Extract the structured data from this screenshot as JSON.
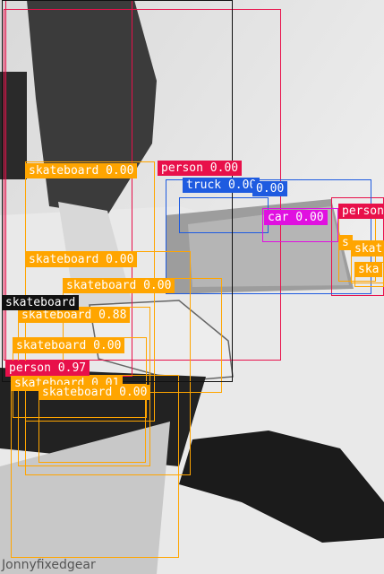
{
  "image": {
    "watermark": "Jonnyfixedgear"
  },
  "colors": {
    "skateboard": "#ffa500",
    "person": "#e8104a",
    "truck": "#1e5be0",
    "car": "#e010e0",
    "black": "#111111"
  },
  "detections": [
    {
      "id": "person-top",
      "class": "person",
      "text": "person 0.00",
      "tagpos": "inside-top"
    },
    {
      "id": "person-right",
      "class": "person",
      "text": "person",
      "tagpos": "inside-top"
    },
    {
      "id": "person-mid",
      "class": "person",
      "text": "person 0.97",
      "tagpos": "inside-top"
    },
    {
      "id": "truck-1",
      "class": "truck",
      "text": "truck 0.00",
      "tagpos": "inside-top"
    },
    {
      "id": "truck-2",
      "class": "truck",
      "text": "0.00",
      "tagpos": "inside-top"
    },
    {
      "id": "car-1",
      "class": "car",
      "text": "car 0.00",
      "tagpos": "inside-top"
    },
    {
      "id": "sk-a",
      "class": "skateboard",
      "text": "skateboard 0.00",
      "tagpos": "inside-top"
    },
    {
      "id": "sk-b",
      "class": "skateboard",
      "text": "skateboard 0.00",
      "tagpos": "inside-top"
    },
    {
      "id": "sk-c",
      "class": "skateboard",
      "text": "skateboard 0.00",
      "tagpos": "inside-top"
    },
    {
      "id": "sk-d",
      "class": "skateboard",
      "text": "skateboard 0.88",
      "tagpos": "inside-top"
    },
    {
      "id": "sk-e",
      "class": "skateboard",
      "text": "skateboard 0.00",
      "tagpos": "inside-top"
    },
    {
      "id": "sk-f",
      "class": "skateboard",
      "text": "skateboard 0.01",
      "tagpos": "inside-top"
    },
    {
      "id": "sk-g",
      "class": "skateboard",
      "text": "skateboard 0.00",
      "tagpos": "inside-top"
    },
    {
      "id": "sk-black",
      "class": "black",
      "text": "skateboard",
      "tagpos": "inside-top"
    },
    {
      "id": "sk-r1",
      "class": "skateboard",
      "text": "s",
      "tagpos": "inside-top"
    },
    {
      "id": "sk-r2",
      "class": "skateboard",
      "text": "skat",
      "tagpos": "inside-top"
    },
    {
      "id": "sk-r3",
      "class": "skateboard",
      "text": "ska",
      "tagpos": "inside-top"
    }
  ]
}
